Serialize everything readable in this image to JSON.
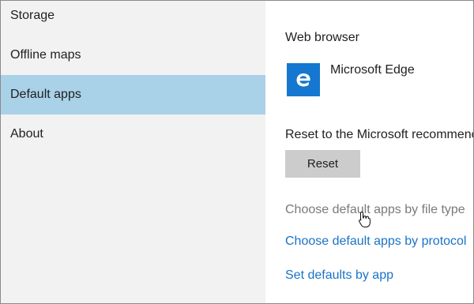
{
  "sidebar": {
    "items": [
      {
        "label": "Storage",
        "selected": false
      },
      {
        "label": "Offline maps",
        "selected": false
      },
      {
        "label": "Default apps",
        "selected": true
      },
      {
        "label": "About",
        "selected": false
      }
    ]
  },
  "main": {
    "web_browser": {
      "title": "Web browser",
      "app_name": "Microsoft Edge",
      "app_icon": "edge-icon",
      "tile_color": "#1577cf"
    },
    "reset": {
      "label": "Reset to the Microsoft recommenc",
      "button_label": "Reset"
    },
    "links": {
      "by_file_type": "Choose default apps by file type",
      "by_protocol": "Choose default apps by protocol",
      "by_app": "Set defaults by app"
    }
  },
  "colors": {
    "sidebar_bg": "#f2f2f2",
    "selected_bg": "#a9d1e8",
    "link_blue": "#1a73c7",
    "link_hover_gray": "#7a7a7a",
    "button_gray": "#cccccc"
  }
}
